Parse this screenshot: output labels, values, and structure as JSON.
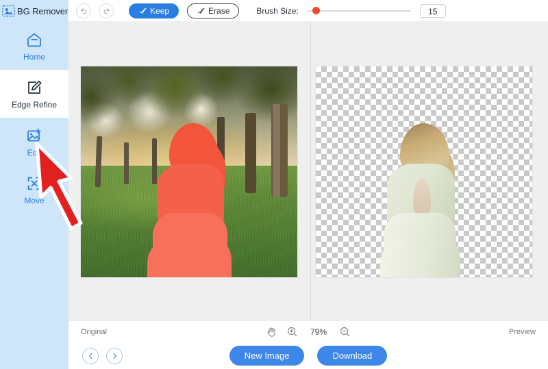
{
  "app": {
    "brand_name": "BG Remover",
    "brand_icon": "image-icon"
  },
  "toolbar": {
    "undo_icon": "undo-icon",
    "redo_icon": "redo-icon",
    "keep_label": "Keep",
    "keep_icon": "brush-icon",
    "erase_label": "Erase",
    "erase_icon": "brush-icon",
    "brush_size_label": "Brush Size:",
    "brush_size_value": "15",
    "slider_min": 1,
    "slider_max": 100,
    "slider_percent": 8,
    "accent_color": "#2a7de1",
    "slider_knob_color": "#f04a32"
  },
  "sidebar": {
    "items": [
      {
        "label": "Home",
        "icon": "home-icon",
        "active": false
      },
      {
        "label": "Edge Refine",
        "icon": "edge-refine-icon",
        "active": true
      },
      {
        "label": "Edit",
        "icon": "edit-image-icon",
        "active": false
      },
      {
        "label": "Move",
        "icon": "move-icon",
        "active": false
      }
    ],
    "background_color": "#cfe6fa",
    "active_background_color": "#ffffff",
    "text_color": "#2a7de1"
  },
  "canvas": {
    "left_pane_name": "original-image-pane",
    "right_pane_name": "result-image-pane",
    "mask_color": "#f4604a",
    "background_color": "#efefef"
  },
  "statusbar": {
    "original_label": "Original",
    "pan_icon": "hand-icon",
    "zoom_in_icon": "zoom-in-icon",
    "zoom_level": "79%",
    "zoom_out_icon": "zoom-out-icon",
    "preview_label": "Preview"
  },
  "footer": {
    "prev_icon": "chevron-left-icon",
    "next_icon": "chevron-right-icon",
    "new_image_label": "New Image",
    "download_label": "Download",
    "button_color": "#3d87e8"
  },
  "cursor": {
    "name": "arrow-pointer",
    "color": "#e32020",
    "points_to": "Edit"
  }
}
